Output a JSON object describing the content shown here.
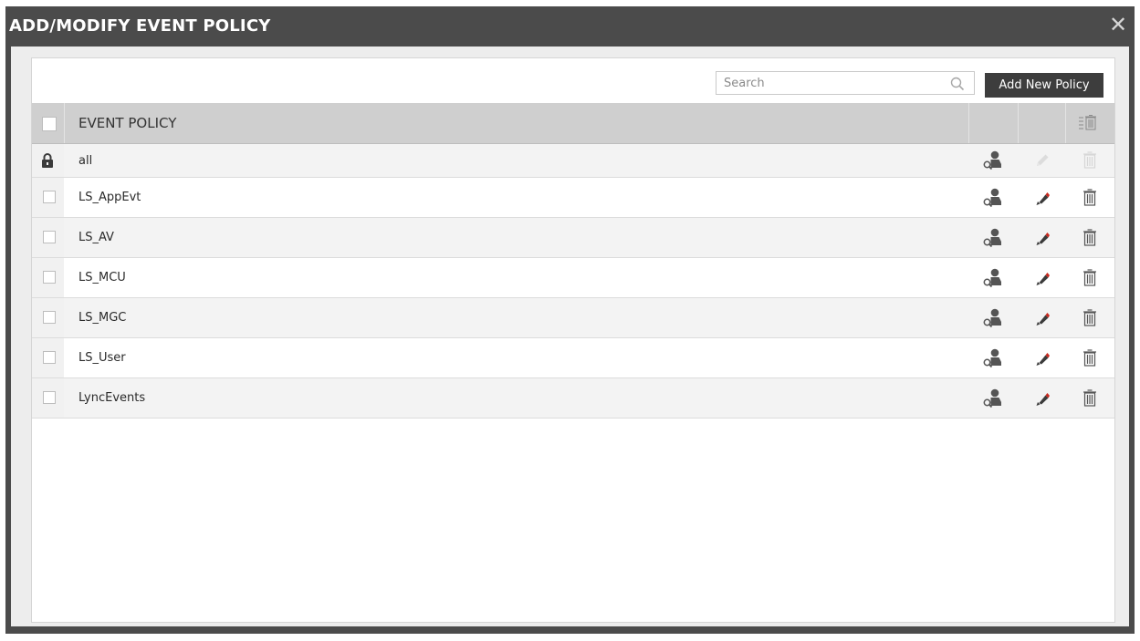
{
  "dialog": {
    "title": "ADD/MODIFY EVENT POLICY",
    "close_icon": "close-icon"
  },
  "toolbar": {
    "search_placeholder": "Search",
    "add_button_label": "Add New Policy"
  },
  "table": {
    "header": {
      "column_label": "EVENT POLICY",
      "bulk_delete_icon": "bulk-delete-icon"
    },
    "rows": [
      {
        "name": "all",
        "locked": true
      },
      {
        "name": "LS_AppEvt",
        "locked": false
      },
      {
        "name": "LS_AV",
        "locked": false
      },
      {
        "name": "LS_MCU",
        "locked": false
      },
      {
        "name": "LS_MGC",
        "locked": false
      },
      {
        "name": "LS_User",
        "locked": false
      },
      {
        "name": "LyncEvents",
        "locked": false
      }
    ],
    "row_actions": [
      "view-user-icon",
      "edit-pencil-icon",
      "trash-icon"
    ]
  },
  "colors": {
    "title_bar": "#4b4b4b",
    "header_bg": "#cfcfcf",
    "edit_accent": "#c8281e",
    "button_bg": "#3d3d3d"
  }
}
